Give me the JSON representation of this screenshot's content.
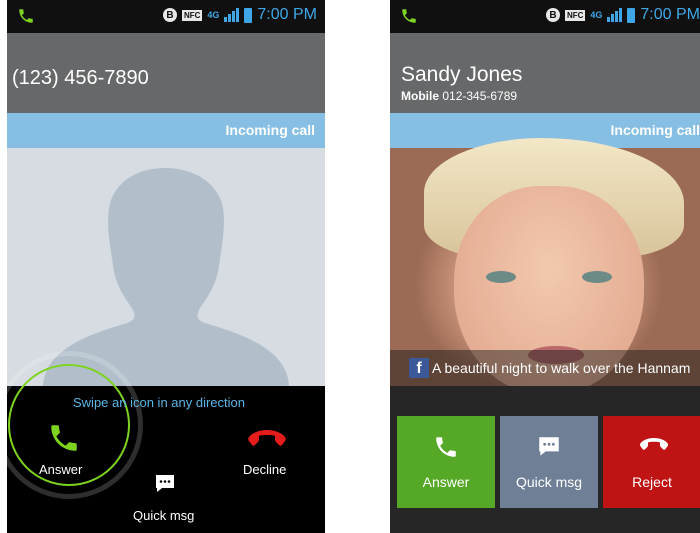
{
  "status": {
    "time": "7:00 PM",
    "lte": "4G",
    "nfc": "NFC",
    "bluetooth": "B"
  },
  "left": {
    "number": "(123) 456-7890",
    "incoming": "Incoming call",
    "swipe_hint": "Swipe an icon in any direction",
    "answer": "Answer",
    "decline": "Decline",
    "quick_msg": "Quick msg"
  },
  "right": {
    "name": "Sandy Jones",
    "sub_label": "Mobile",
    "sub_number": "012-345-6789",
    "incoming": "Incoming call",
    "status_message": "A beautiful night to walk over the Hannam",
    "facebook_glyph": "f",
    "answer": "Answer",
    "quick_msg": "Quick msg",
    "reject": "Reject"
  },
  "colors": {
    "answer": "#56a927",
    "quick_msg": "#6f7f95",
    "reject": "#c01414",
    "accent": "#3fa7e6",
    "bar": "#86bfe3"
  }
}
